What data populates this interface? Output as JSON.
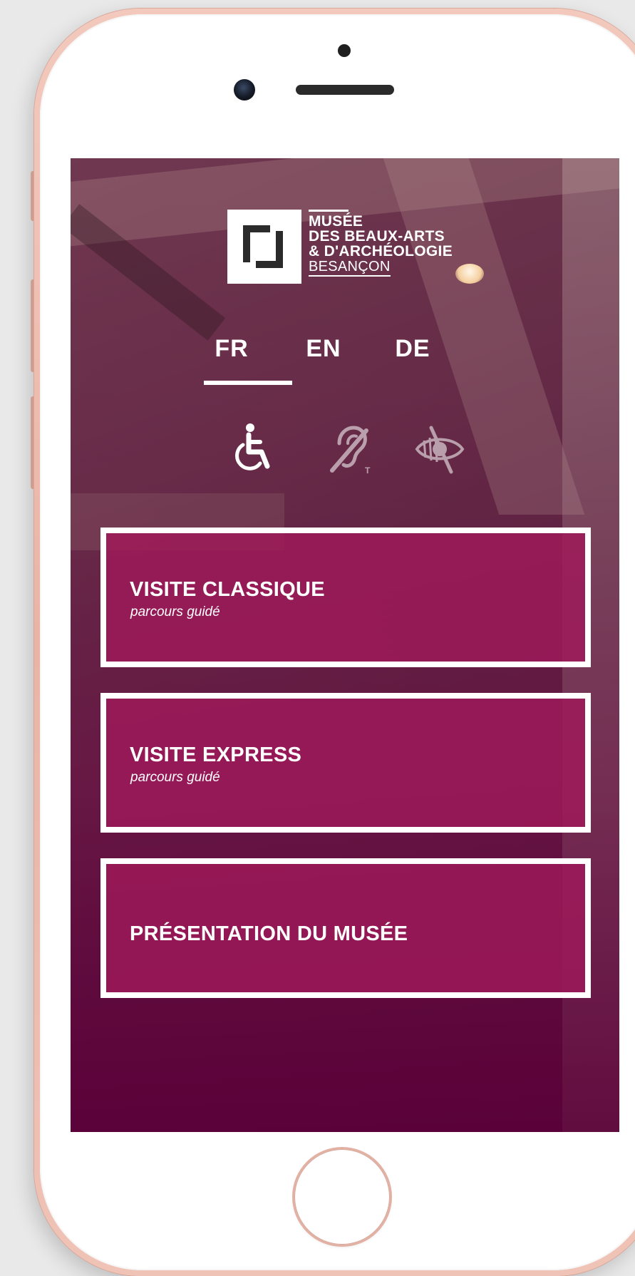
{
  "app": {
    "logo": {
      "line1": "MUSÉE",
      "line2": "DES BEAUX-ARTS",
      "line3": "& D'ARCHÉOLOGIE",
      "line4": "BESANÇON"
    },
    "languages": [
      {
        "label": "FR",
        "selected": true
      },
      {
        "label": "EN",
        "selected": false
      },
      {
        "label": "DE",
        "selected": false
      }
    ],
    "accessibility_icons": [
      "wheelchair-icon",
      "hearing-impaired-icon",
      "visually-impaired-icon"
    ],
    "menu": [
      {
        "title": "VISITE CLASSIQUE",
        "subtitle": "parcours guidé"
      },
      {
        "title": "VISITE EXPRESS",
        "subtitle": "parcours guidé"
      },
      {
        "title": "PRÉSENTATION DU MUSÉE",
        "subtitle": ""
      }
    ]
  },
  "colors": {
    "accent": "#a01a5a",
    "overlay_dark": "#5c003a",
    "text": "#ffffff",
    "phone_frame": "#efc3b6"
  }
}
